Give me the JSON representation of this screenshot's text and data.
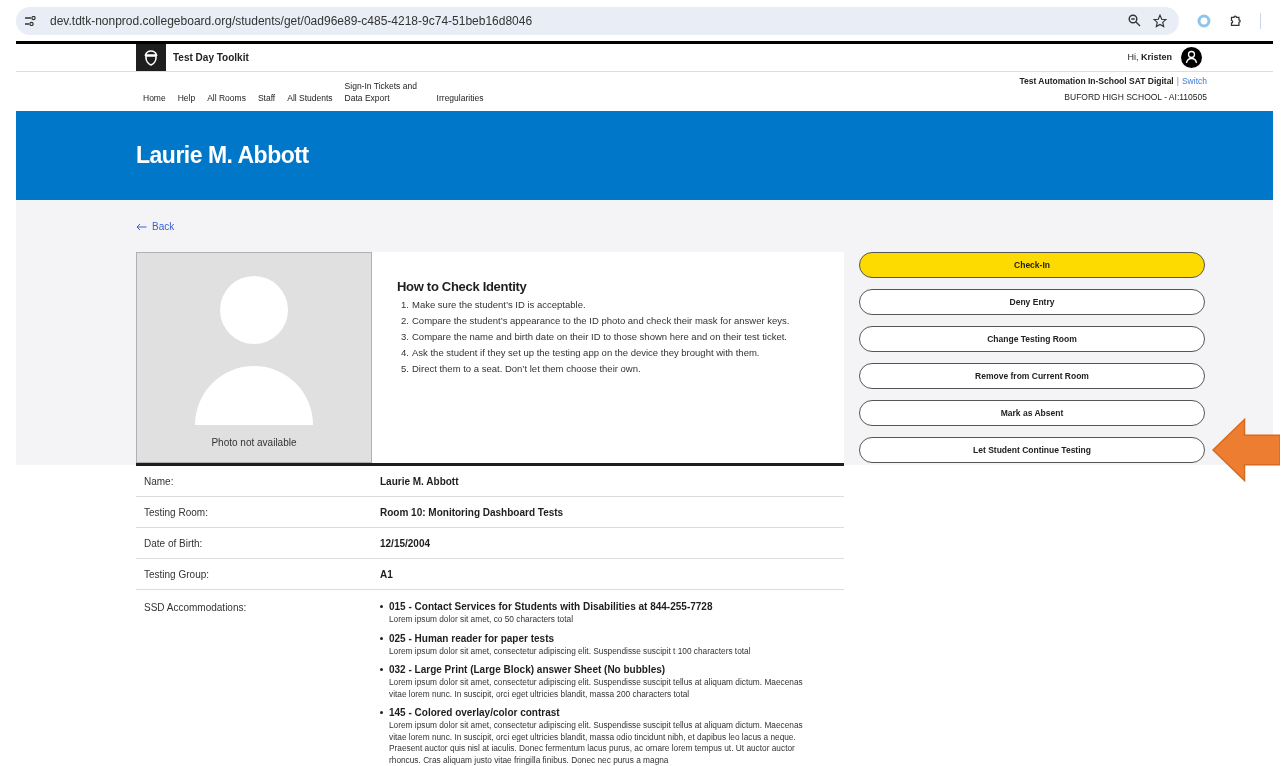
{
  "browser": {
    "url": "dev.tdtk-nonprod.collegeboard.org/students/get/0ad96e89-c485-4218-9c74-51beb16d8046"
  },
  "header": {
    "app_title": "Test Day Toolkit",
    "greeting": "Hi,",
    "user_name": "Kristen"
  },
  "nav": [
    {
      "label": "Home"
    },
    {
      "label": "Help"
    },
    {
      "label": "All Rooms"
    },
    {
      "label": "Staff"
    },
    {
      "label": "All Students"
    },
    {
      "label": "Sign-In Tickets and Data Export"
    },
    {
      "label": "Irregularities"
    }
  ],
  "program": {
    "name": "Test Automation In-School SAT Digital",
    "separator": "|",
    "link": "Switch",
    "school": "BUFORD HIGH SCHOOL - AI:110505"
  },
  "student_name": "Laurie M. Abbott",
  "back_link": "Back",
  "photo": {
    "caption": "Photo not available"
  },
  "identity": {
    "title": "How to Check Identity",
    "steps": [
      {
        "number": "1.",
        "text": "Make sure the student’s ID is acceptable."
      },
      {
        "number": "2.",
        "text": "Compare the student’s appearance to the ID photo and check their mask for answer keys."
      },
      {
        "number": "3.",
        "text": "Compare the name and birth date on their ID to those shown here and on their test ticket."
      },
      {
        "number": "4.",
        "text": "Ask the student if they set up the testing app on the device they brought with them."
      },
      {
        "number": "5.",
        "text": "Direct them to a seat. Don’t let them choose their own."
      }
    ]
  },
  "details": [
    {
      "label": "Name:",
      "value": "Laurie M. Abbott"
    },
    {
      "label": "Testing Room:",
      "value": "Room 10: Monitoring Dashboard Tests"
    },
    {
      "label": "Date of Birth:",
      "value": "12/15/2004"
    },
    {
      "label": "Testing Group:",
      "value": "A1"
    }
  ],
  "accommodations": {
    "label": "SSD Accommodations:",
    "items": [
      {
        "title": "015 - Contact Services for Students with Disabilities at 844-255-7728",
        "description": "Lorem ipsum dolor sit amet, co 50 characters total"
      },
      {
        "title": "025 - Human reader for paper tests",
        "description": "Lorem ipsum dolor sit amet, consectetur adipiscing elit. Suspendisse suscipit t 100 characters total"
      },
      {
        "title": "032 - Large Print (Large Block) answer Sheet (No bubbles)",
        "description": "Lorem ipsum dolor sit amet, consectetur adipiscing elit. Suspendisse suscipit tellus at aliquam dictum. Maecenas vitae lorem nunc. In suscipit, orci eget ultricies blandit, massa 200 characters total"
      },
      {
        "title": "145 - Colored overlay/color contrast",
        "description": "Lorem ipsum dolor sit amet, consectetur adipiscing elit. Suspendisse suscipit tellus at aliquam dictum. Maecenas vitae lorem nunc. In suscipit, orci eget ultricies blandit, massa odio tincidunt nibh, et dapibus leo lacus a neque. Praesent auctor quis nisl at iaculis. Donec fermentum lacus purus, ac ornare lorem tempus ut. Ut auctor auctor rhoncus. Cras aliquam justo vitae fringilla finibus. Donec nec purus a magna"
      }
    ]
  },
  "actions": [
    {
      "label": "Check-In",
      "kind": "primary"
    },
    {
      "label": "Deny Entry",
      "kind": "secondary"
    },
    {
      "label": "Change Testing Room",
      "kind": "secondary"
    },
    {
      "label": "Remove from Current Room",
      "kind": "secondary"
    },
    {
      "label": "Mark as Absent",
      "kind": "secondary"
    },
    {
      "label": "Let Student Continue Testing",
      "kind": "secondary"
    }
  ]
}
